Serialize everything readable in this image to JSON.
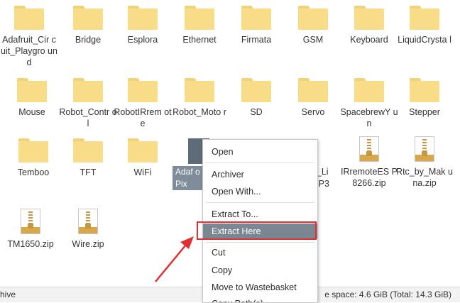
{
  "folders": [
    {
      "label": "Adafruit_Cir cuit_Playgro und"
    },
    {
      "label": "Bridge"
    },
    {
      "label": "Esplora"
    },
    {
      "label": "Ethernet"
    },
    {
      "label": "Firmata"
    },
    {
      "label": "GSM"
    },
    {
      "label": "Keyboard"
    },
    {
      "label": "LiquidCrysta l"
    },
    {
      "label": "Mouse"
    },
    {
      "label": "Robot_Contr ol"
    },
    {
      "label": "RobotIRrem ote"
    },
    {
      "label": "Robot_Moto r"
    },
    {
      "label": "SD"
    },
    {
      "label": "Servo"
    },
    {
      "label": "SpacebrewY un"
    },
    {
      "label": "Stepper"
    },
    {
      "label": "Temboo"
    },
    {
      "label": "TFT"
    },
    {
      "label": "WiFi"
    }
  ],
  "zips": [
    {
      "label": "Adaf oPix"
    },
    {
      "label": "33_Li ESP3 p"
    },
    {
      "label": "IRremoteES P8266.zip"
    },
    {
      "label": "Rtc_by_Mak una.zip"
    },
    {
      "label": "TM1650.zip"
    },
    {
      "label": "Wire.zip"
    }
  ],
  "context_menu": {
    "open": "Open",
    "archiver": "Archiver",
    "open_with": "Open With...",
    "extract_to": "Extract To...",
    "extract_here": "Extract Here",
    "cut": "Cut",
    "copy": "Copy",
    "move_to_wastebasket": "Move to Wastebasket",
    "copy_path": "Copy Path(s)"
  },
  "statusbar": {
    "left": "hive",
    "right": "e space: 4.6 GiB (Total: 14.3 GiB)"
  },
  "colors": {
    "folder": "#f8dc88",
    "highlight": "#7a8793",
    "annotation": "#e03131"
  }
}
